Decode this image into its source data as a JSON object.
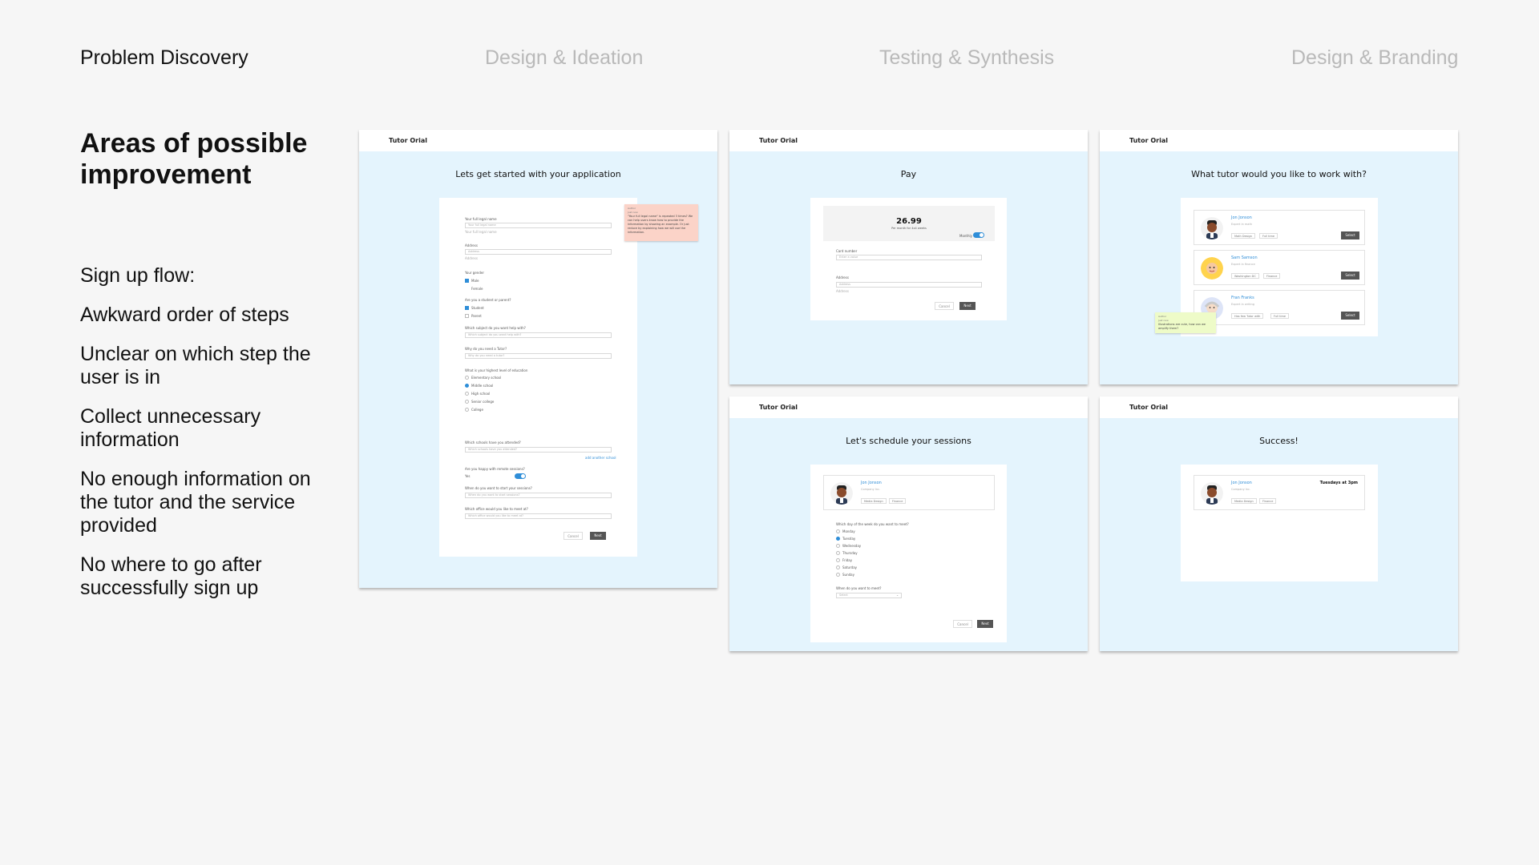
{
  "nav": {
    "steps": [
      "Problem Discovery",
      "Design & Ideation",
      "Testing & Synthesis",
      "Design & Branding"
    ]
  },
  "title": "Areas of possible improvement",
  "issues": [
    "Sign up flow:",
    "Awkward order of steps",
    "Unclear on which step the user is in",
    "Collect unnecessary information",
    "No enough information on the tutor and the service provided",
    "No where to go after successfully sign up"
  ],
  "app_name": "Tutor Orial",
  "colors": {
    "accent": "#2f8ed8",
    "card_bg": "#e4f4fd",
    "note_red": "#fbd3c8",
    "note_green": "#eefbc8"
  },
  "screen1": {
    "heading": "Lets get started with your application",
    "name_label": "Your full legal name",
    "name_placeholder": "Your full legal name",
    "name_hint": "Your full legal name",
    "address_label": "Address",
    "address_placeholder": "Address",
    "address_hint": "Address",
    "gender_label": "Your gender",
    "gender_options": [
      "Male",
      "Female"
    ],
    "status_label": "Are you a student or parent?",
    "status_options": [
      "Student",
      "Parent"
    ],
    "subject_label": "Which subject do you want help with?",
    "subject_placeholder": "Which subject do you want help with?",
    "why_label": "Why do you need a Tutor?",
    "why_placeholder": "Why do you need a tutor?",
    "edu_label": "What is your highest level of education",
    "edu_options": [
      "Elementary school",
      "Middle school",
      "High school",
      "Senior college",
      "College"
    ],
    "schools_label": "Which schools have you attended?",
    "schools_placeholder": "Which schools have you attended?",
    "add_school": "add another school",
    "remote_label": "Are you happy with remote sessions?",
    "remote_value": "Yes",
    "start_label": "When do you want to start your sessions?",
    "start_placeholder": "When do you want to start sessions?",
    "office_label": "Which office would you like to meet at?",
    "office_placeholder": "Which office would you like to meet at?",
    "cancel": "Cancel",
    "next": "Next",
    "comment_author": "Author",
    "comment_time": "Just now",
    "comment_text": "\"Your full legal name\" is repeated 3 times? We can help users know how to provide the information by showing an example. Or just reduce by explaining how we will use the information."
  },
  "screen2": {
    "heading": "Pay",
    "price": "26.99",
    "price_sub": "Per month for 4x4 weeks",
    "monthly_label": "Monthly",
    "card_label": "Card number",
    "card_placeholder": "Enter a value",
    "address_label": "Address",
    "address_placeholder": "Address",
    "address_hint": "Address",
    "cancel": "Cancel",
    "next": "Next"
  },
  "screen3": {
    "heading": "What tutor would you like to work with?",
    "tutors": [
      {
        "name": "Jon Jonson",
        "sub": "Expert in math",
        "tags": [
          "Math Design",
          "Full time"
        ],
        "select": "Select"
      },
      {
        "name": "Sam Samson",
        "sub": "Expert in finance",
        "tags": [
          "Washington DC",
          "Finance"
        ],
        "select": "Select"
      },
      {
        "name": "Fran Franks",
        "sub": "Expert in writing",
        "tags": [
          "Has few Tutor with",
          "Full time"
        ],
        "select": "Select"
      }
    ],
    "comment_author": "Author",
    "comment_time": "Just now",
    "comment_text": "Illustrations are cute, how can we amplify them?"
  },
  "screen4": {
    "heading": "Let's schedule your sessions",
    "tutor_name": "Jon Jonson",
    "tutor_sub": "Company Inc.",
    "tags": [
      "Media Design",
      "Finance"
    ],
    "day_label": "Which day of the week do you want to meet?",
    "days": [
      "Monday",
      "Tuesday",
      "Wednesday",
      "Thursday",
      "Friday",
      "Saturday",
      "Sunday"
    ],
    "time_label": "When do you want to meet?",
    "time_select": "Select",
    "cancel": "Cancel",
    "next": "Next"
  },
  "screen5": {
    "heading": "Success!",
    "tutor_name": "Jon Jonson",
    "tutor_sub": "Company Inc.",
    "tags": [
      "Media Design",
      "Finance"
    ],
    "schedule": "Tuesdays at 3pm"
  }
}
